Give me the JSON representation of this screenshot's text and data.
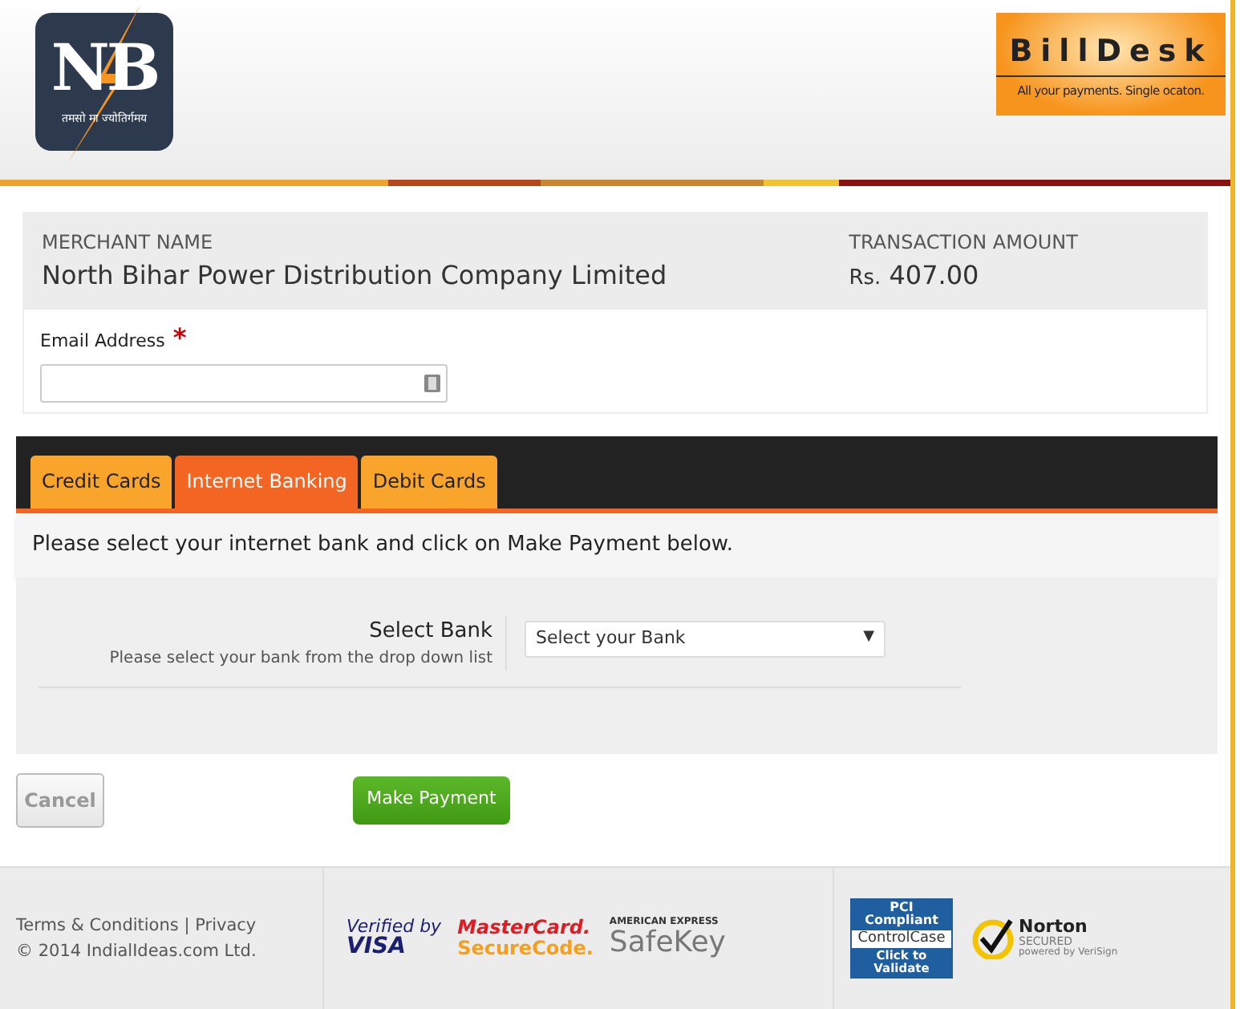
{
  "header": {
    "logo": {
      "letters": "NB",
      "motto": "तमसो मा ज्योतिर्गमय"
    },
    "partner_logo": {
      "name": "BillDesk",
      "tagline": "All your payments. Single ocaton."
    }
  },
  "merchant": {
    "name_label": "MERCHANT NAME",
    "name": "North Bihar Power Distribution Company Limited",
    "amount_label": "TRANSACTION AMOUNT",
    "currency": "Rs.",
    "amount": "407.00"
  },
  "email": {
    "label": "Email Address",
    "required_mark": "*"
  },
  "tabs": [
    {
      "label": "Credit Cards",
      "selected": false
    },
    {
      "label": "Internet Banking",
      "selected": true
    },
    {
      "label": "Debit Cards",
      "selected": false
    }
  ],
  "instruction": "Please select your internet bank and click on Make Payment below.",
  "bank": {
    "label": "Select Bank",
    "hint": "Please select your bank from the drop down list",
    "value": "Select your Bank",
    "arrow": "▼"
  },
  "buttons": {
    "cancel": {
      "label": "Cancel",
      "disabled": true
    },
    "pay": {
      "label": "Make Payment"
    }
  },
  "footer": {
    "links": [
      "Terms & Conditions",
      "Privacy"
    ],
    "separator": "|",
    "copyright": "© 2014 IndialIdeas.com Ltd.",
    "badges": [
      {
        "kind": "visa",
        "lines": [
          "Verified by",
          "VISA"
        ]
      },
      {
        "kind": "mastercard",
        "lines": [
          "MasterCard.",
          "SecureCode."
        ]
      },
      {
        "kind": "amex",
        "lines": [
          "AMERICAN EXPRESS",
          "SafeKey"
        ]
      },
      {
        "kind": "pci",
        "lines": [
          "PCI Compliant",
          "ControlCase",
          "Click to Validate"
        ]
      },
      {
        "kind": "norton",
        "lines": [
          "Norton",
          "SECURED",
          "powered by VeriSign"
        ]
      }
    ]
  }
}
